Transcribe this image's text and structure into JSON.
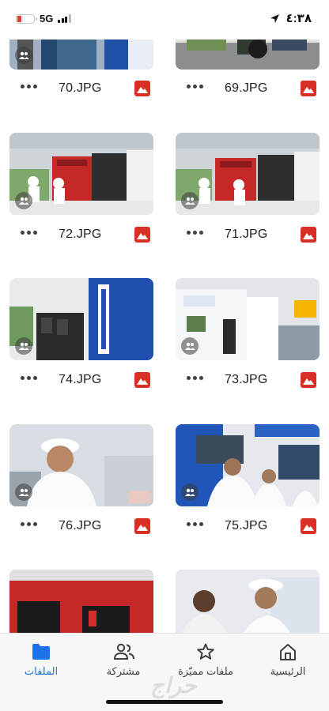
{
  "status_bar": {
    "network": "5G",
    "time": "٤:٣٨"
  },
  "files": [
    {
      "name": "70.JPG",
      "shared": true
    },
    {
      "name": "69.JPG",
      "shared": false
    },
    {
      "name": "72.JPG",
      "shared": true
    },
    {
      "name": "71.JPG",
      "shared": true
    },
    {
      "name": "74.JPG",
      "shared": true
    },
    {
      "name": "73.JPG",
      "shared": true
    },
    {
      "name": "76.JPG",
      "shared": true
    },
    {
      "name": "75.JPG",
      "shared": true
    }
  ],
  "bottom_nav": {
    "files": "الملفات",
    "shared": "مشتركة",
    "starred": "ملفات مميّزة",
    "home": "الرئيسية"
  },
  "watermark": "حراج",
  "colors": {
    "accent": "#1a73e8",
    "image_icon": "#d93025",
    "nav_bg": "#f7f7f7"
  }
}
